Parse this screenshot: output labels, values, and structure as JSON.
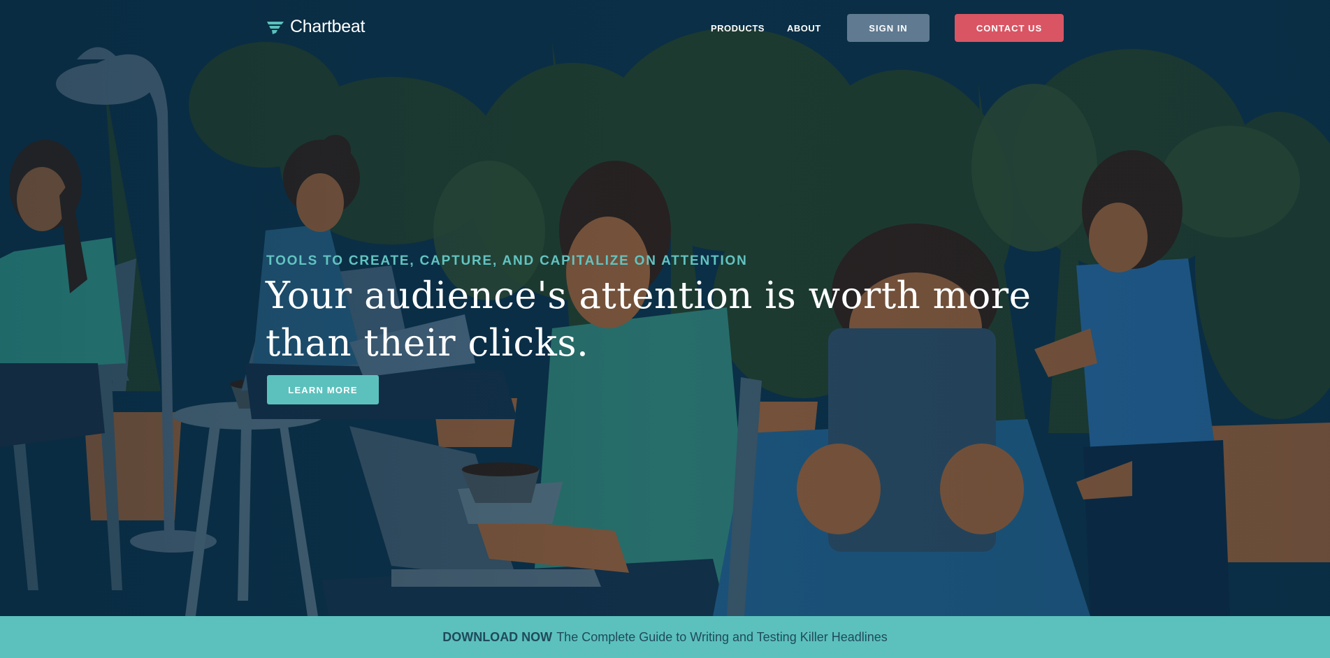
{
  "brand": {
    "name": "Chartbeat"
  },
  "nav": {
    "products": "PRODUCTS",
    "about": "ABOUT",
    "sign_in": "SIGN IN",
    "contact": "CONTACT US"
  },
  "hero": {
    "kicker": "TOOLS TO CREATE, CAPTURE, AND CAPITALIZE ON ATTENTION",
    "headline": "Your audience's attention is worth more than their clicks.",
    "cta": "LEARN MORE"
  },
  "banner": {
    "strong": "DOWNLOAD NOW",
    "text": "The Complete Guide to Writing and Testing Killer Headlines"
  },
  "colors": {
    "background": "#0b3149",
    "accent_teal": "#5cc1bd",
    "contact_red": "#d95563",
    "signin_slate": "#5f7a91"
  }
}
